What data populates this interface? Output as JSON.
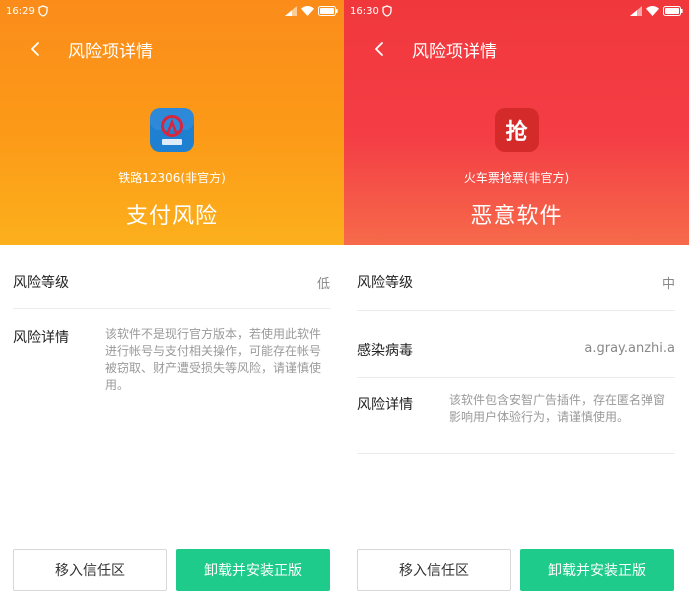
{
  "left": {
    "status_time": "16:29",
    "title": "风险项详情",
    "app_name": "铁路12306(非官方)",
    "risk_type": "支付风险",
    "app_icon_label": "中国铁路",
    "rows": {
      "level_label": "风险等级",
      "level_value": "低",
      "detail_label": "风险详情",
      "detail_text": "该软件不是现行官方版本，若使用此软件进行帐号与支付相关操作，可能存在帐号被窃取、财产遭受损失等风险，请谨慎使用。"
    },
    "buttons": {
      "trust": "移入信任区",
      "reinstall": "卸载并安装正版"
    }
  },
  "right": {
    "status_time": "16:30",
    "title": "风险项详情",
    "app_name": "火车票抢票(非官方)",
    "risk_type": "恶意软件",
    "app_icon_label": "抢",
    "rows": {
      "level_label": "风险等级",
      "level_value": "中",
      "virus_label": "感染病毒",
      "virus_value": "a.gray.anzhi.a",
      "detail_label": "风险详情",
      "detail_text": "该软件包含安智广告插件，存在匿名弹窗影响用户体验行为，请谨慎使用。"
    },
    "buttons": {
      "trust": "移入信任区",
      "reinstall": "卸载并安装正版"
    }
  },
  "colors": {
    "left_hero": "#fb8c1a",
    "right_hero": "#f0383c",
    "primary_button": "#1ecb8a",
    "app_icon_blue": "#1f7fd0",
    "app_icon_red": "#d42a2a"
  },
  "icons": [
    "back-arrow-icon",
    "shield-icon",
    "signal-icon",
    "wifi-icon",
    "battery-icon",
    "railway-logo-icon",
    "qiangpiao-app-icon"
  ]
}
